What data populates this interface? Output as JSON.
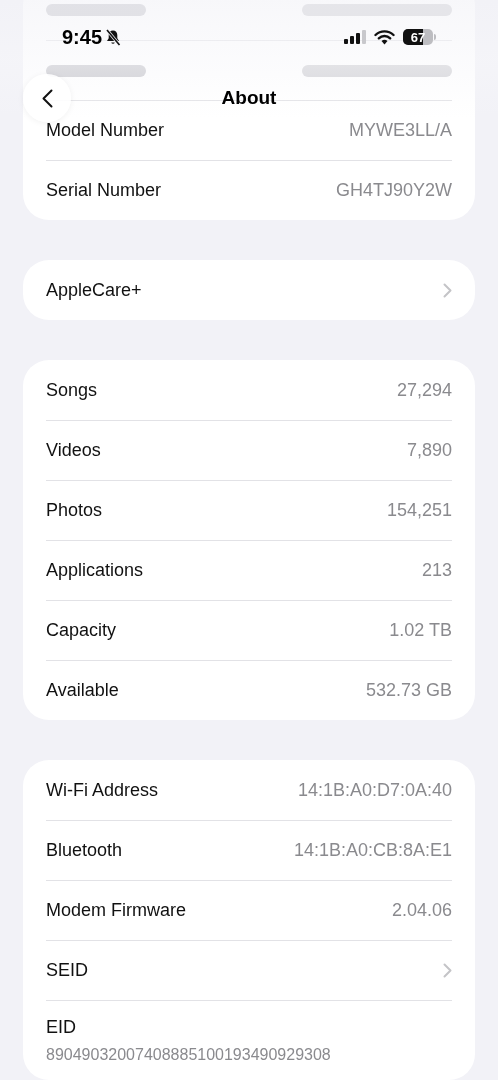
{
  "status_bar": {
    "time": "9:45",
    "battery": "67"
  },
  "nav": {
    "title": "About"
  },
  "sections": [
    {
      "rows": [
        {
          "kind": "blurred"
        },
        {
          "kind": "blurred"
        },
        {
          "kind": "inline",
          "label": "Model Number",
          "value": "MYWE3LL/A",
          "disclosure": false
        },
        {
          "kind": "inline",
          "label": "Serial Number",
          "value": "GH4TJ90Y2W",
          "disclosure": false
        }
      ]
    },
    {
      "rows": [
        {
          "kind": "inline",
          "label": "AppleCare+",
          "disclosure": true
        }
      ]
    },
    {
      "rows": [
        {
          "kind": "inline",
          "label": "Songs",
          "value": "27,294",
          "disclosure": false
        },
        {
          "kind": "inline",
          "label": "Videos",
          "value": "7,890",
          "disclosure": false
        },
        {
          "kind": "inline",
          "label": "Photos",
          "value": "154,251",
          "disclosure": false
        },
        {
          "kind": "inline",
          "label": "Applications",
          "value": "213",
          "disclosure": false
        },
        {
          "kind": "inline",
          "label": "Capacity",
          "value": "1.02 TB",
          "disclosure": false
        },
        {
          "kind": "inline",
          "label": "Available",
          "value": "532.73 GB",
          "disclosure": false
        }
      ]
    },
    {
      "rows": [
        {
          "kind": "inline",
          "label": "Wi-Fi Address",
          "value": "14:1B:A0:D7:0A:40",
          "disclosure": false
        },
        {
          "kind": "inline",
          "label": "Bluetooth",
          "value": "14:1B:A0:CB:8A:E1",
          "disclosure": false
        },
        {
          "kind": "inline",
          "label": "Modem Firmware",
          "value": "2.04.06",
          "disclosure": false
        },
        {
          "kind": "inline",
          "label": "SEID",
          "disclosure": true
        },
        {
          "kind": "stacked",
          "label": "EID",
          "value": "89049032007408885100193490929308",
          "disclosure": false
        }
      ]
    }
  ]
}
